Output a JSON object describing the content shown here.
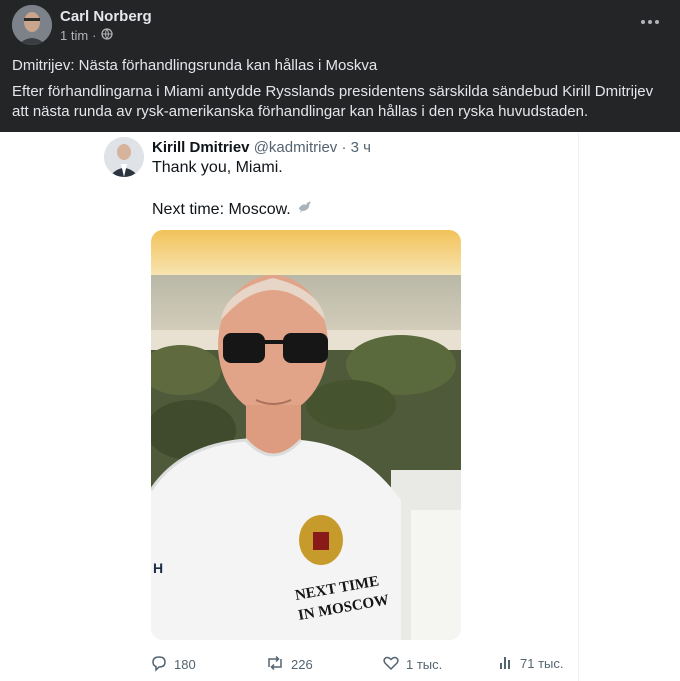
{
  "post": {
    "author": "Carl Norberg",
    "time": "1 tim",
    "dot": "·",
    "headline": "Dmitrijev: Nästa förhandlingsrunda kan hållas i Moskva",
    "body": "Efter förhandlingarna i Miami antydde Rysslands presidentens särskilda sändebud Kirill Dmitrijev att nästa runda av rysk-amerikanska förhandlingar kan hållas i den ryska huvudstaden."
  },
  "tweet": {
    "name": "Kirill Dmitriev",
    "handle": "@kadmitriev",
    "dot": "·",
    "time": "3 ч",
    "line1": "Thank you, Miami.",
    "line2": "Next time: Moscow.",
    "shirt_text_1": "NEXT TIME",
    "shirt_text_2": "IN MOSCOW",
    "shirt_brand": "H",
    "actions": {
      "replies": "180",
      "reposts": "226",
      "likes": "1 тыс.",
      "views": "71 тыс."
    }
  },
  "icons": [
    "globe-icon",
    "more-options-icon",
    "dove-icon",
    "reply-icon",
    "repost-icon",
    "like-icon",
    "views-icon"
  ],
  "colors": {
    "fb_background": "#242526",
    "fb_text": "#e4e6eb",
    "fb_secondary": "#b0b3b8",
    "tweet_text": "#0f1419",
    "tweet_secondary": "#536471"
  }
}
